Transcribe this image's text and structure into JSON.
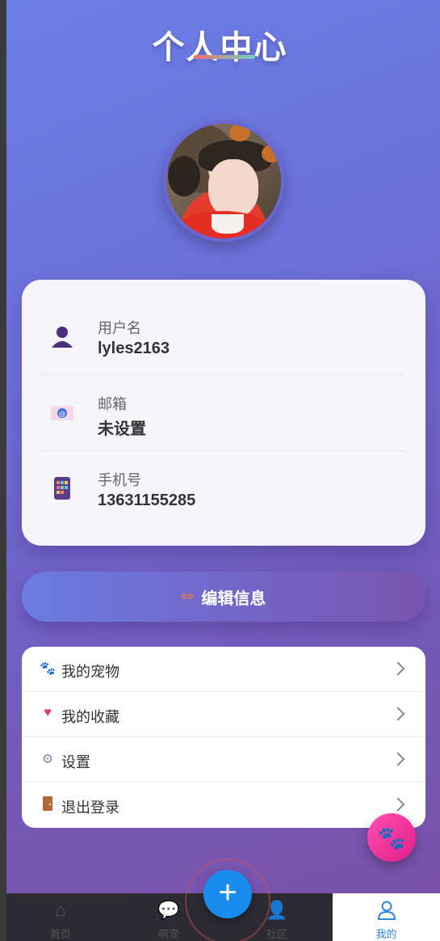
{
  "header": {
    "title": "个人中心"
  },
  "profile": {
    "username_label": "用户名",
    "username": "lyles2163",
    "email_label": "邮箱",
    "email": "未设置",
    "phone_label": "手机号",
    "phone": "13631155285"
  },
  "icons": {
    "user": "user-icon",
    "email": "envelope-icon",
    "phone": "phone-icon"
  },
  "actions": {
    "edit_label": "编辑信息"
  },
  "menu": {
    "items": [
      {
        "label": "我的宠物",
        "icon": "paws-icon"
      },
      {
        "label": "我的收藏",
        "icon": "heart-icon"
      },
      {
        "label": "设置",
        "icon": "gear-icon"
      },
      {
        "label": "退出登录",
        "icon": "door-icon"
      }
    ]
  },
  "tabs": [
    {
      "label": "首页",
      "icon": "home-icon"
    },
    {
      "label": "萌宠",
      "icon": "chat-icon"
    },
    {
      "label": "社区",
      "icon": "community-icon"
    },
    {
      "label": "我的",
      "icon": "profile-icon",
      "active": true
    }
  ],
  "colors": {
    "accent": "#1a8cf0",
    "active_tab": "#2d86e0",
    "fab": "#e31e8a"
  }
}
